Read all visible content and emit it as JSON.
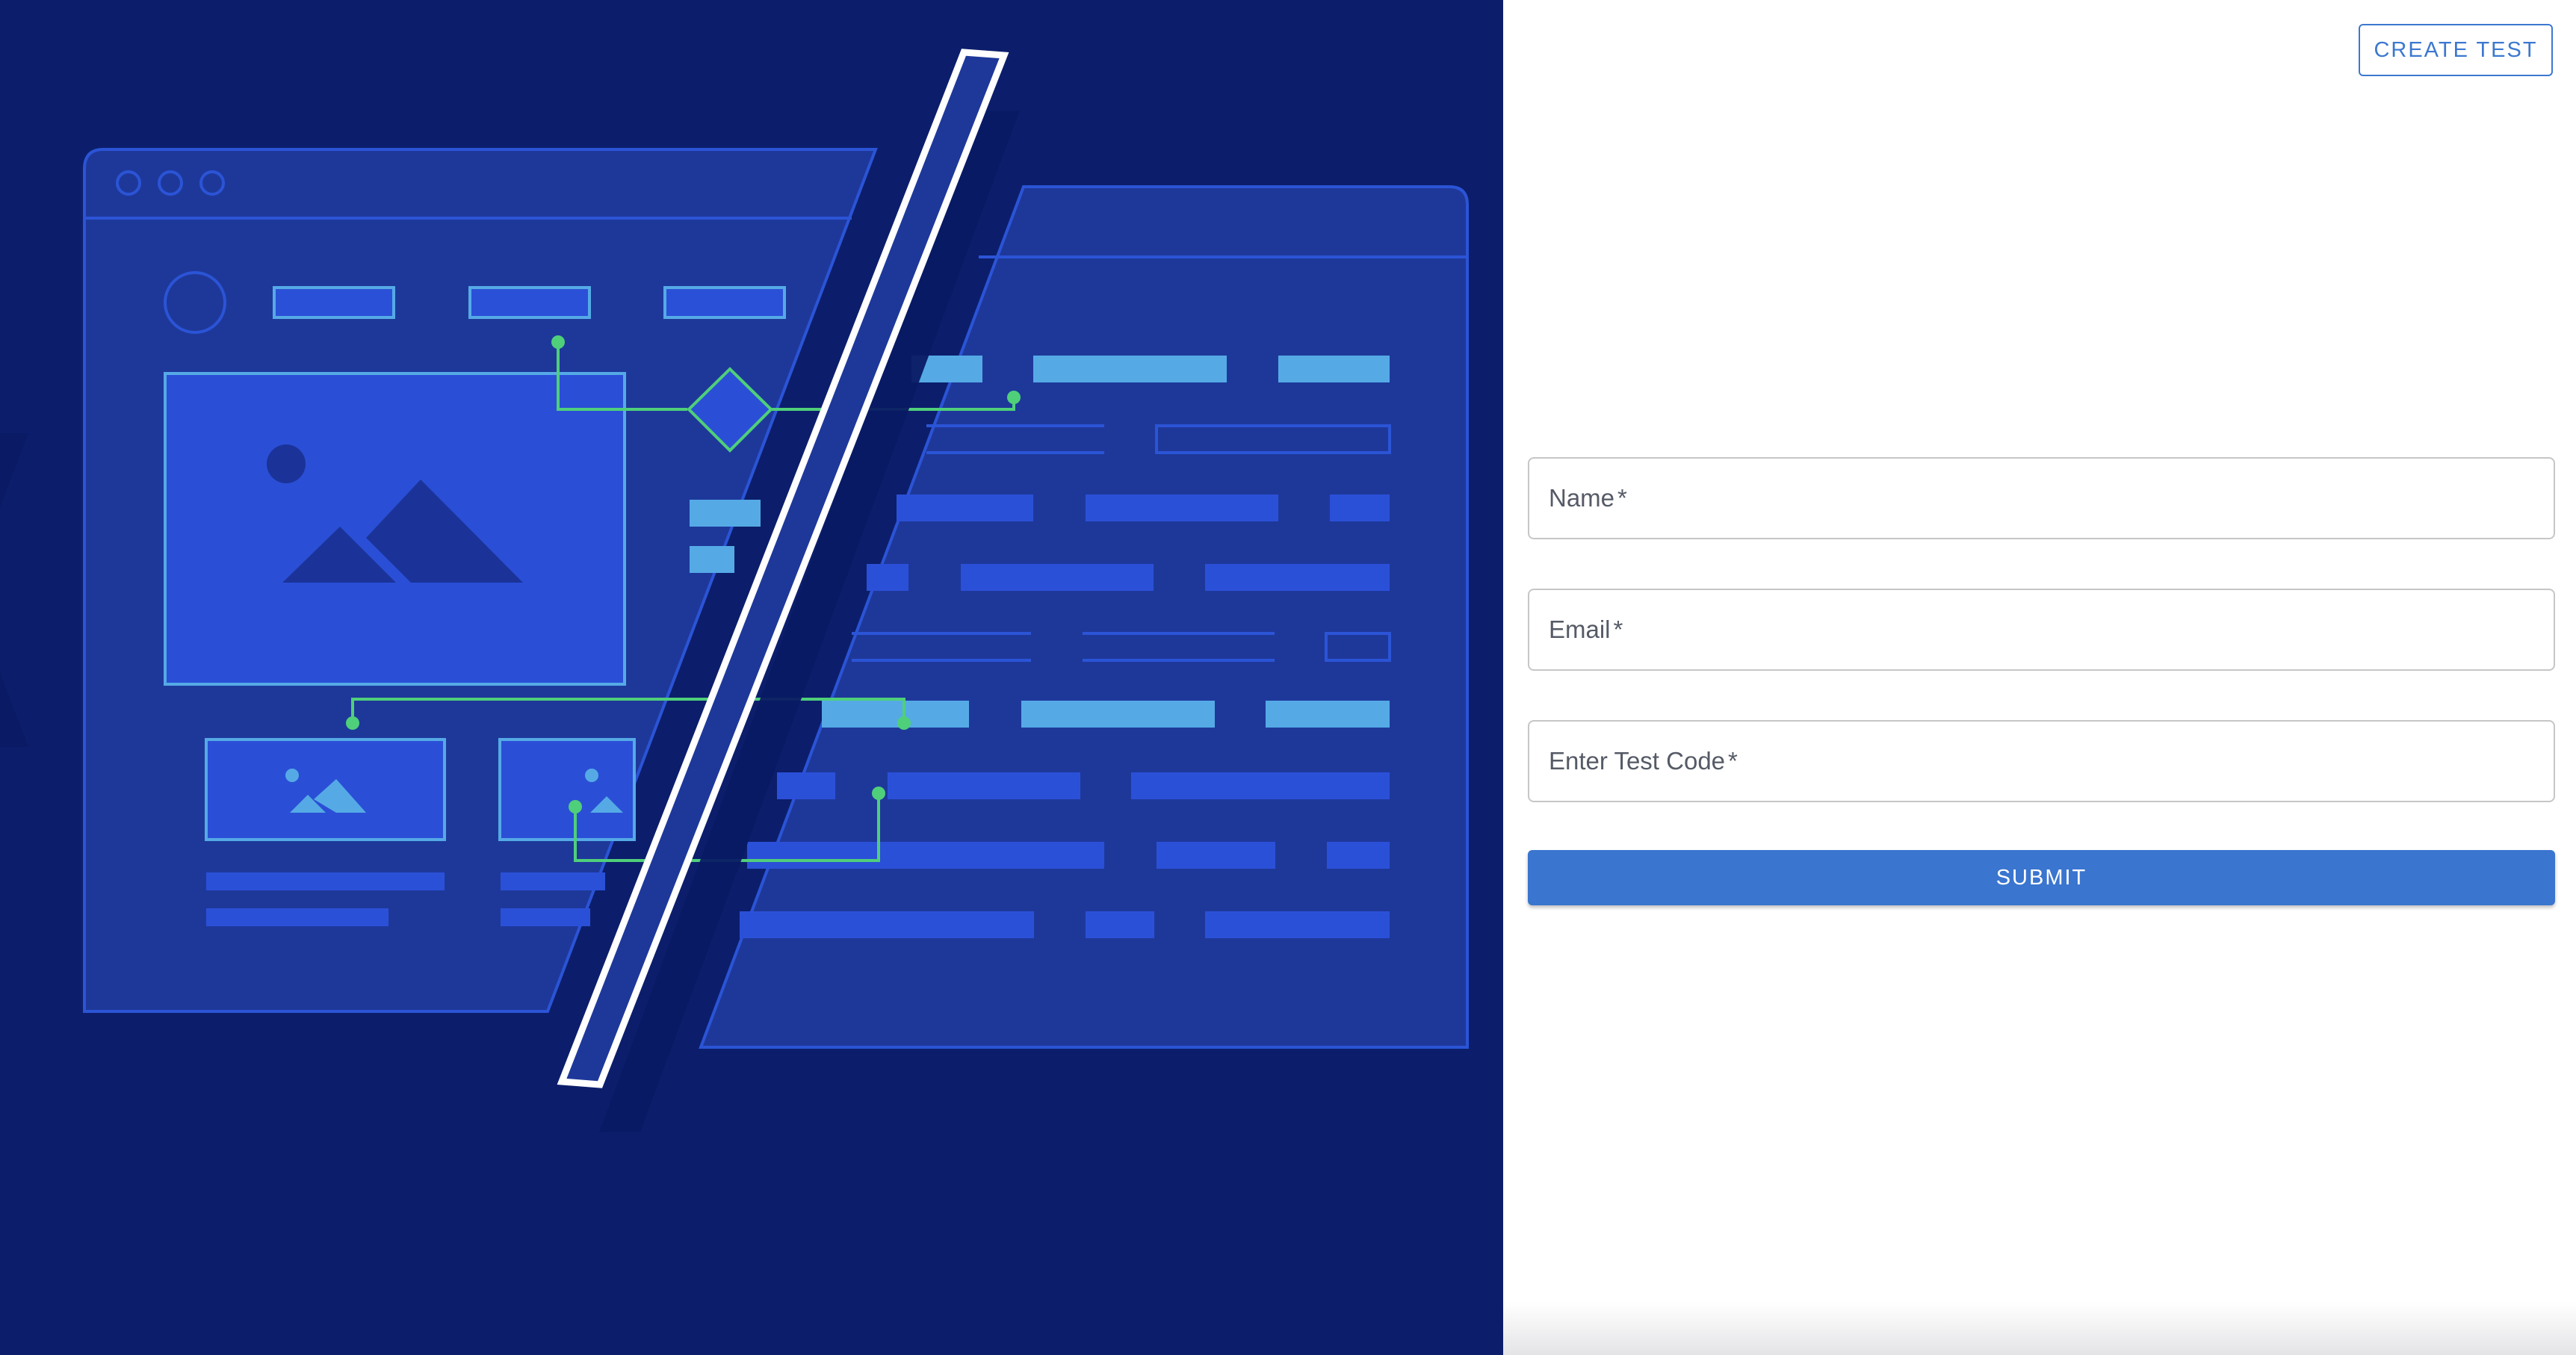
{
  "header": {
    "create_test_label": "CREATE TEST"
  },
  "form": {
    "fields": [
      {
        "label": "Name",
        "required_mark": "*"
      },
      {
        "label": "Email",
        "required_mark": "*"
      },
      {
        "label": "Enter Test Code",
        "required_mark": "*"
      }
    ],
    "submit_label": "SUBMIT"
  },
  "colors": {
    "hero_background": "#0c1e6b",
    "accent": "#3a75cf",
    "illustration_connector": "#4fcf7a"
  },
  "icons": [
    "window-dots-icon",
    "image-placeholder-icon",
    "diamond-icon",
    "avatar-circle-icon"
  ]
}
